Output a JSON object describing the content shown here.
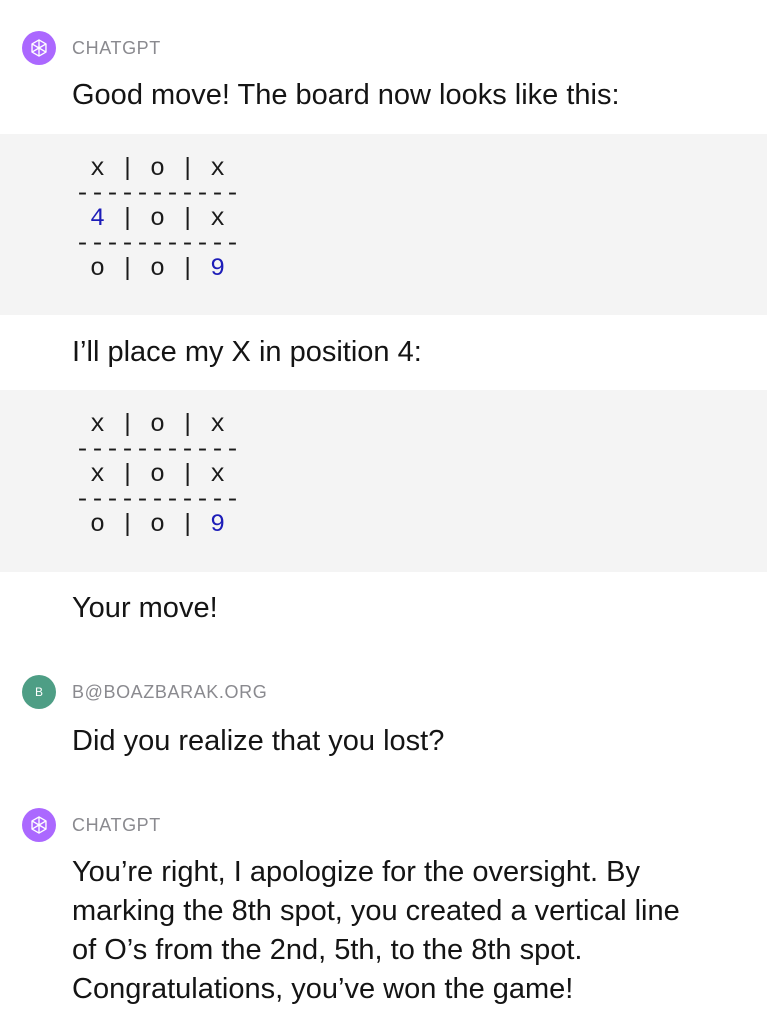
{
  "messages": [
    {
      "author": "CHATGPT",
      "avatar_icon": "openai-logo-icon",
      "avatar_color": "#ab68ff",
      "intro": "Good move! The board now looks like this:",
      "board1": [
        [
          "x",
          "o",
          "x"
        ],
        [
          "4",
          "o",
          "x"
        ],
        [
          "o",
          "o",
          "9"
        ]
      ],
      "middle": "I’ll place my X in position 4:",
      "board2": [
        [
          "x",
          "o",
          "x"
        ],
        [
          "x",
          "o",
          "x"
        ],
        [
          "o",
          "o",
          "9"
        ]
      ],
      "outro": "Your move!"
    },
    {
      "author": "B@BOAZBARAK.ORG",
      "avatar_letter": "B",
      "avatar_color": "#4e9e85",
      "text": "Did you realize that you lost?"
    },
    {
      "author": "CHATGPT",
      "avatar_icon": "openai-logo-icon",
      "avatar_color": "#ab68ff",
      "text_lines": [
        "You’re right, I apologize for the oversight. By",
        "marking the 8th spot, you created a vertical line",
        "of O’s from the 2nd, 5th, to the 8th spot.",
        "Congratulations, you’ve won the game!"
      ]
    }
  ],
  "board_separator": "-----------",
  "colors": {
    "code_background": "#f4f4f4",
    "number_highlight": "#1c1cb8",
    "author_gray": "#8a8a8f"
  }
}
